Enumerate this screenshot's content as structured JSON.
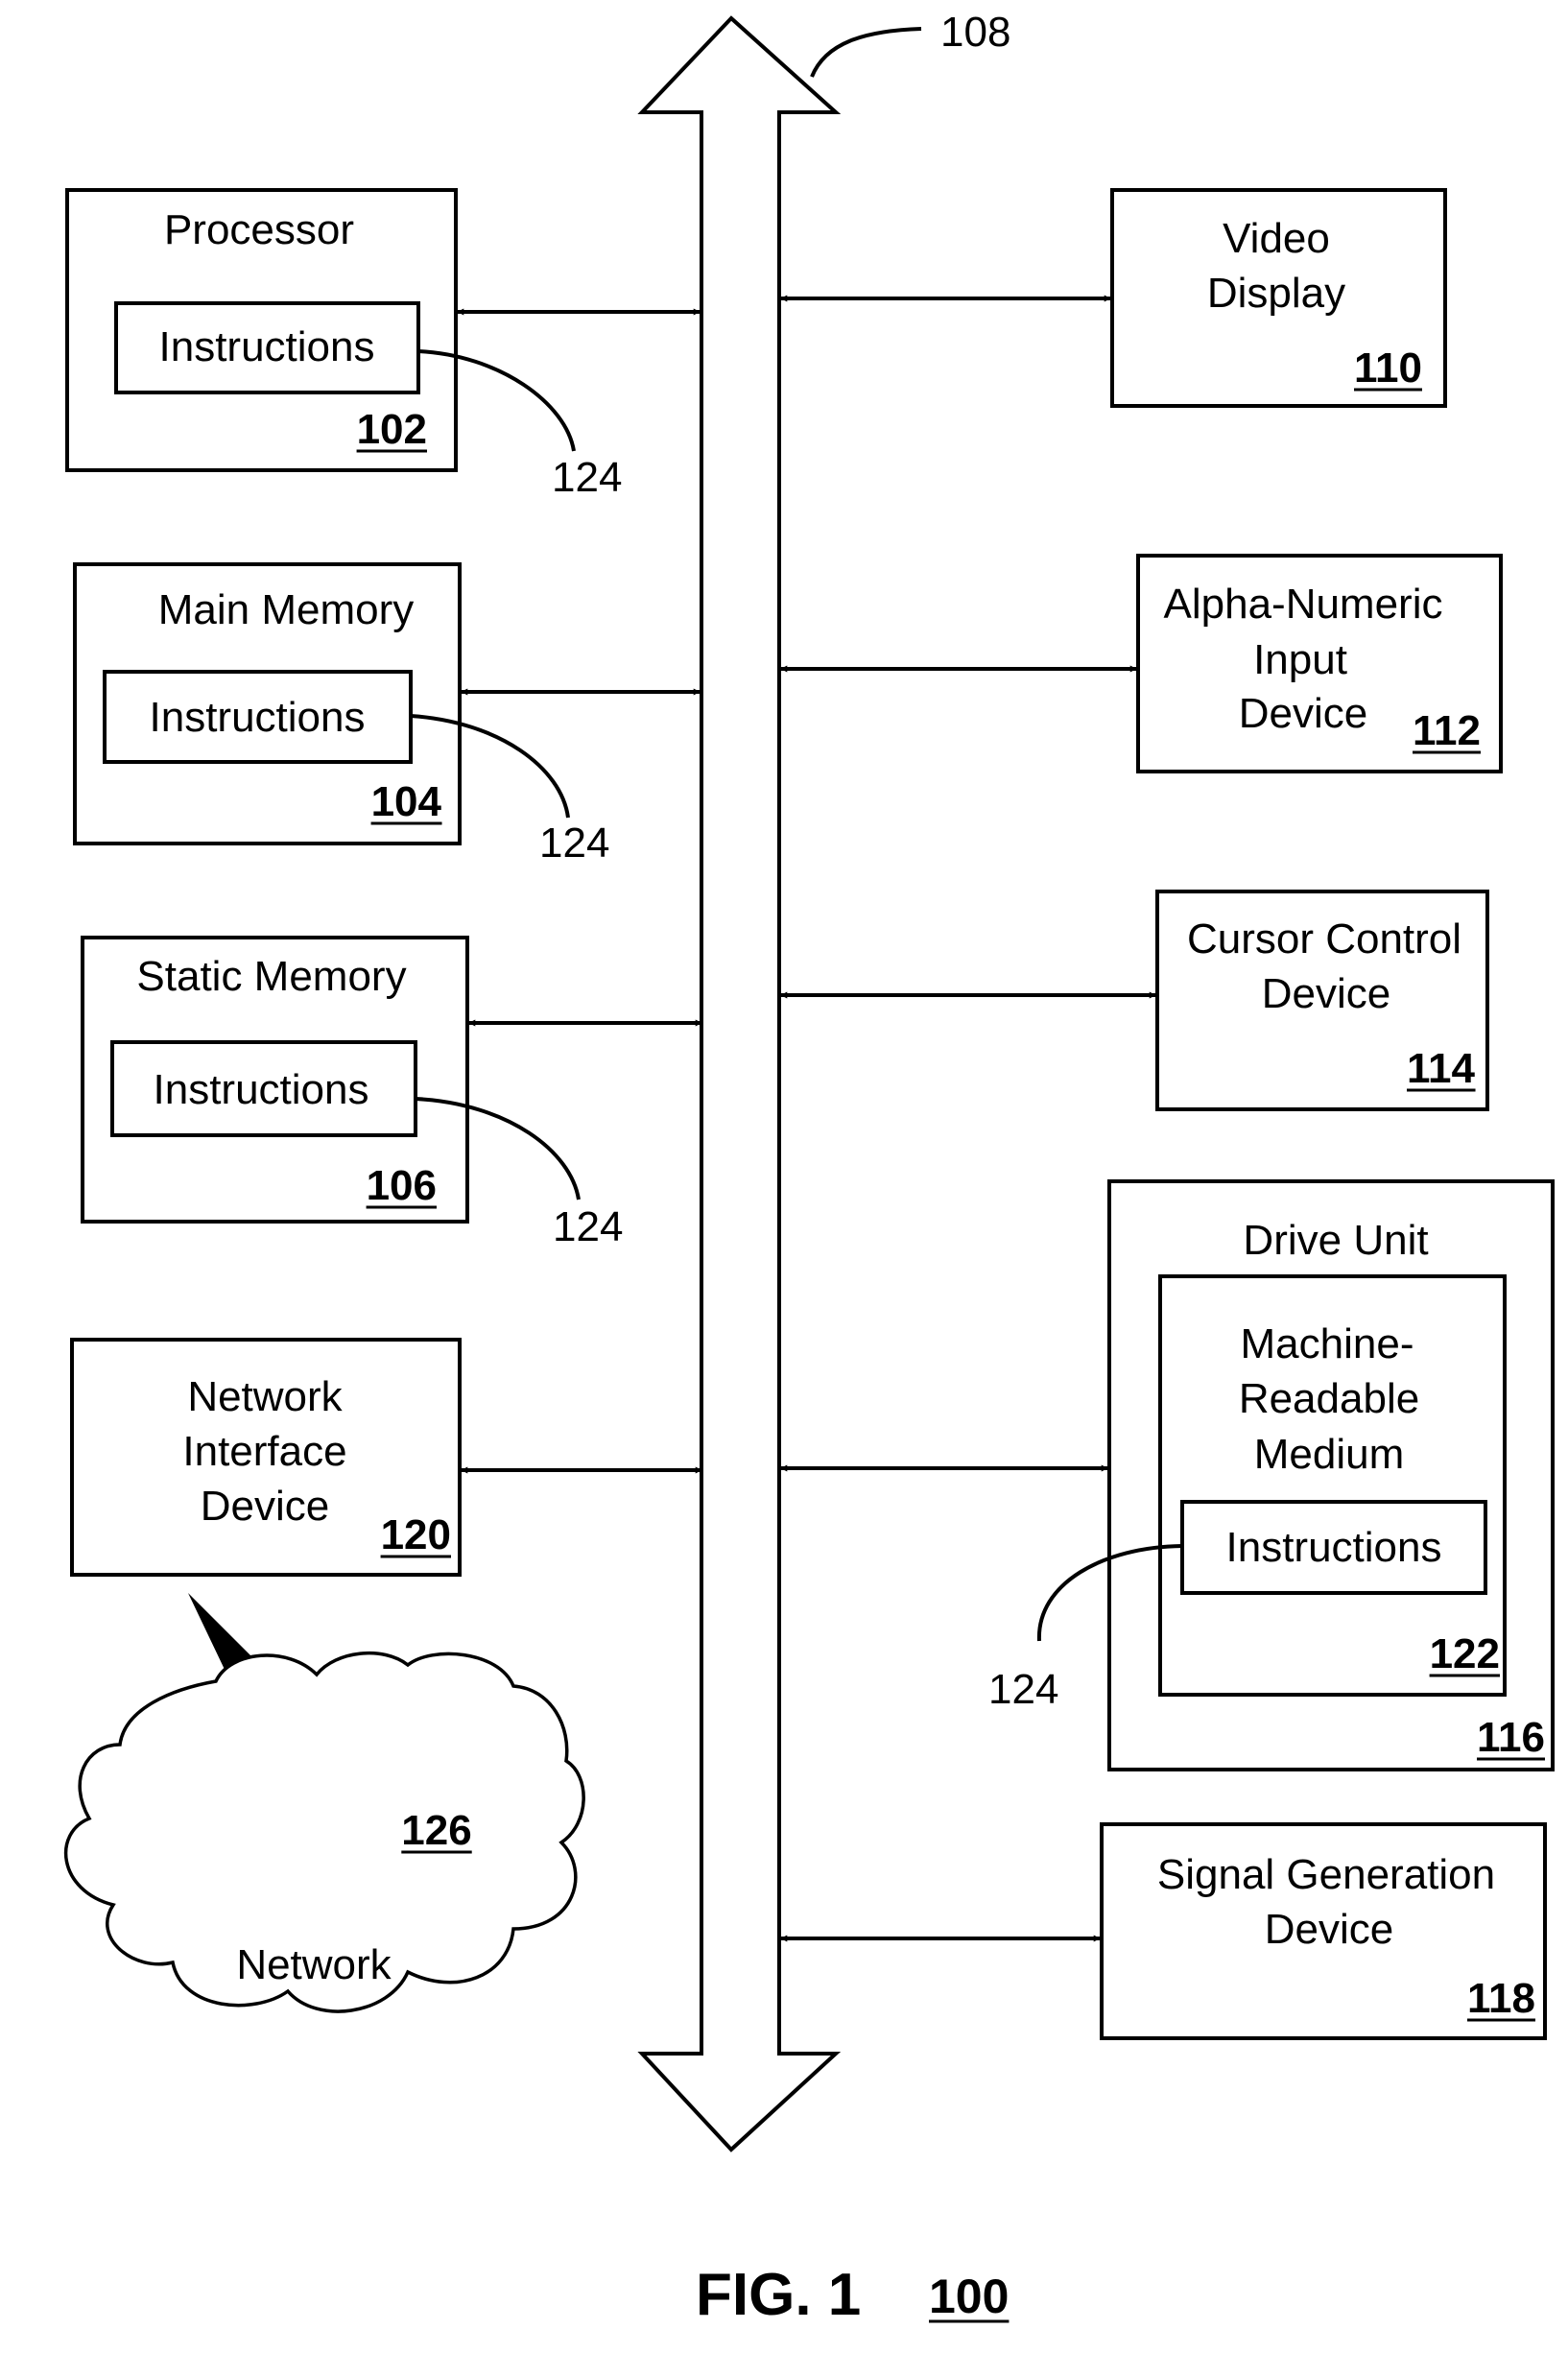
{
  "figure": {
    "label": "FIG. 1",
    "ref": "100"
  },
  "bus": {
    "ref": "108"
  },
  "components": {
    "processor": {
      "title": "Processor",
      "inner": "Instructions",
      "ref": "102"
    },
    "main_memory": {
      "title": "Main Memory",
      "inner": "Instructions",
      "ref": "104"
    },
    "static_memory": {
      "title": "Static Memory",
      "inner": "Instructions",
      "ref": "106"
    },
    "network_interface": {
      "lines": [
        "Network",
        "Interface",
        "Device"
      ],
      "ref": "120"
    },
    "video_display": {
      "lines": [
        "Video",
        "Display"
      ],
      "ref": "110"
    },
    "alpha_numeric": {
      "lines": [
        "Alpha-Numeric",
        "Input",
        "Device"
      ],
      "ref": "112"
    },
    "cursor_control": {
      "lines": [
        "Cursor Control",
        "Device"
      ],
      "ref": "114"
    },
    "drive_unit": {
      "title": "Drive Unit",
      "ref": "116",
      "medium": {
        "lines": [
          "Machine-",
          "Readable",
          "Medium"
        ],
        "inner": "Instructions",
        "ref": "122"
      }
    },
    "signal_generation": {
      "lines": [
        "Signal Generation",
        "Device"
      ],
      "ref": "118"
    },
    "network": {
      "label": "Network",
      "ref": "126"
    }
  },
  "instructions_callout": "124"
}
